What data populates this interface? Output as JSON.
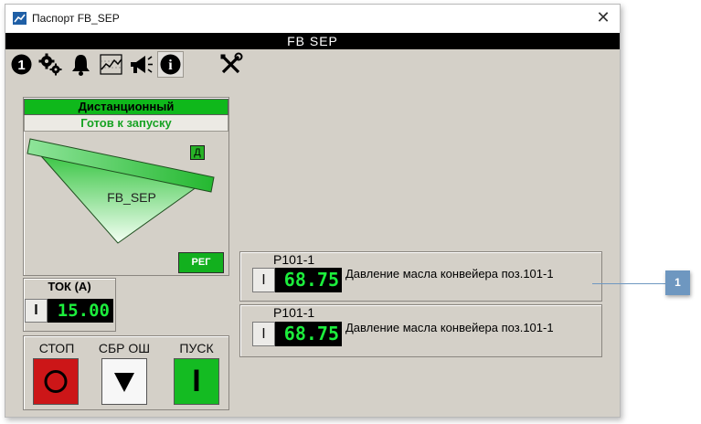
{
  "window": {
    "title": "Паспорт FB_SEP",
    "close_glyph": "✕"
  },
  "header": {
    "title": "FB  SEP"
  },
  "toolbar": {
    "buttons": [
      {
        "name": "number-one-icon",
        "label": "1"
      },
      {
        "name": "gears-icon"
      },
      {
        "name": "bell-icon"
      },
      {
        "name": "trend-chart-icon"
      },
      {
        "name": "megaphone-icon"
      },
      {
        "name": "info-icon",
        "label": "i",
        "active": true
      },
      {
        "name": "tools-icon"
      }
    ]
  },
  "device": {
    "mode": "Дистанционный",
    "state": "Готов к запуску",
    "name": "FB_SEP",
    "d_badge": "Д",
    "reg_button": "РЕГ"
  },
  "tok": {
    "title": "ТОК (А)",
    "button": "I",
    "value": "15.00"
  },
  "controls": {
    "stop_label": "СТОП",
    "reset_label": "СБР ОШ",
    "start_label": "ПУСК",
    "start_glyph": "I"
  },
  "sensors": [
    {
      "tag": "P101-1",
      "button": "I",
      "value": "68.75",
      "description": "Давление масла конвейера поз.101-1"
    },
    {
      "tag": "P101-1",
      "button": "I",
      "value": "68.75",
      "description": "Давление масла конвейера поз.101-1"
    }
  ],
  "callout": {
    "label": "1"
  },
  "colors": {
    "panel_bg": "#d4d0c8",
    "green": "#0fb81b",
    "value_green": "#1cee3c",
    "stop_red": "#cc1618",
    "callout_blue": "#6e97c0"
  }
}
